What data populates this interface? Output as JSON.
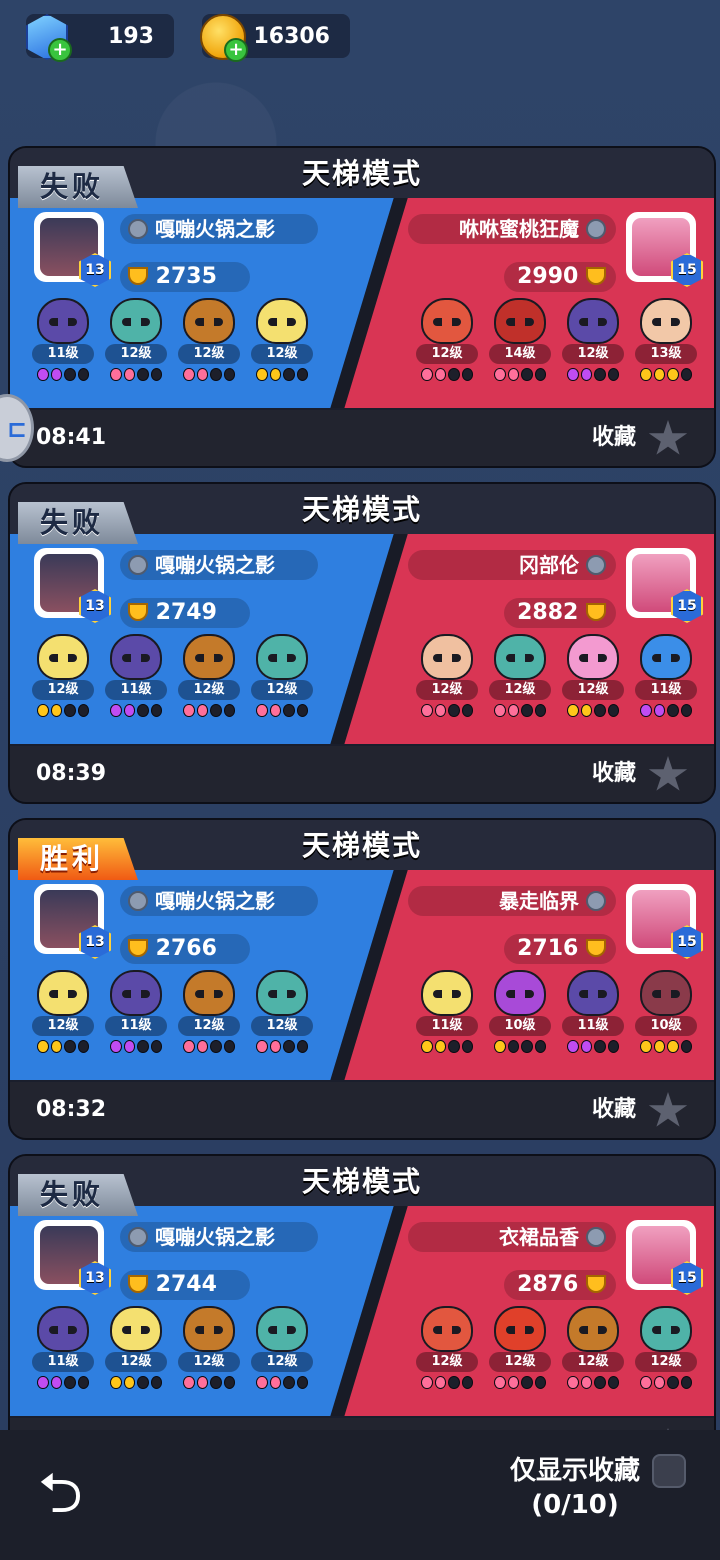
{
  "resources": {
    "gems": "193",
    "coins": "16306",
    "gem_icon": "gem-icon",
    "coin_icon": "coin-icon",
    "plus_symbol": "+"
  },
  "matches": [
    {
      "mode": "天梯模式",
      "result": "失败",
      "time": "08:41",
      "fav_label": "收藏",
      "left": {
        "name": "嘎嘣火锅之影",
        "score": "2735",
        "level": "13",
        "units": [
          {
            "lv": "11级",
            "color": "#5b4aa8",
            "dots": [
              "purple",
              "purple",
              "off",
              "off"
            ]
          },
          {
            "lv": "12级",
            "color": "#4fb3a8",
            "dots": [
              "pink",
              "pink",
              "off",
              "off"
            ]
          },
          {
            "lv": "12级",
            "color": "#c47a2a",
            "dots": [
              "pink",
              "pink",
              "off",
              "off"
            ]
          },
          {
            "lv": "12级",
            "color": "#f4e070",
            "dots": [
              "gold",
              "gold",
              "off",
              "off"
            ]
          }
        ]
      },
      "right": {
        "name": "咻咻蜜桃狂魔",
        "score": "2990",
        "level": "15",
        "units": [
          {
            "lv": "12级",
            "color": "#e2573f",
            "dots": [
              "pink",
              "pink",
              "off",
              "off"
            ]
          },
          {
            "lv": "14级",
            "color": "#c0302a",
            "dots": [
              "pink",
              "pink",
              "off",
              "off"
            ]
          },
          {
            "lv": "12级",
            "color": "#5b4aa8",
            "dots": [
              "purple",
              "purple",
              "off",
              "off"
            ]
          },
          {
            "lv": "13级",
            "color": "#f2c8a8",
            "dots": [
              "gold",
              "gold",
              "gold",
              "off"
            ]
          }
        ]
      }
    },
    {
      "mode": "天梯模式",
      "result": "失败",
      "time": "08:39",
      "fav_label": "收藏",
      "left": {
        "name": "嘎嘣火锅之影",
        "score": "2749",
        "level": "13",
        "units": [
          {
            "lv": "12级",
            "color": "#f4e070",
            "dots": [
              "gold",
              "gold",
              "off",
              "off"
            ]
          },
          {
            "lv": "11级",
            "color": "#5b4aa8",
            "dots": [
              "purple",
              "purple",
              "off",
              "off"
            ]
          },
          {
            "lv": "12级",
            "color": "#c47a2a",
            "dots": [
              "pink",
              "pink",
              "off",
              "off"
            ]
          },
          {
            "lv": "12级",
            "color": "#4fb3a8",
            "dots": [
              "pink",
              "pink",
              "off",
              "off"
            ]
          }
        ]
      },
      "right": {
        "name": "冈部伦",
        "score": "2882",
        "level": "15",
        "units": [
          {
            "lv": "12级",
            "color": "#f0c0a0",
            "dots": [
              "pink",
              "pink",
              "off",
              "off"
            ]
          },
          {
            "lv": "12级",
            "color": "#4fb3a8",
            "dots": [
              "pink",
              "pink",
              "off",
              "off"
            ]
          },
          {
            "lv": "12级",
            "color": "#f39ad0",
            "dots": [
              "gold",
              "gold",
              "off",
              "off"
            ]
          },
          {
            "lv": "11级",
            "color": "#3b8ee8",
            "dots": [
              "purple",
              "purple",
              "off",
              "off"
            ]
          }
        ]
      }
    },
    {
      "mode": "天梯模式",
      "result": "胜利",
      "time": "08:32",
      "fav_label": "收藏",
      "left": {
        "name": "嘎嘣火锅之影",
        "score": "2766",
        "level": "13",
        "units": [
          {
            "lv": "12级",
            "color": "#f4e070",
            "dots": [
              "gold",
              "gold",
              "off",
              "off"
            ]
          },
          {
            "lv": "11级",
            "color": "#5b4aa8",
            "dots": [
              "purple",
              "purple",
              "off",
              "off"
            ]
          },
          {
            "lv": "12级",
            "color": "#c47a2a",
            "dots": [
              "pink",
              "pink",
              "off",
              "off"
            ]
          },
          {
            "lv": "12级",
            "color": "#4fb3a8",
            "dots": [
              "pink",
              "pink",
              "off",
              "off"
            ]
          }
        ]
      },
      "right": {
        "name": "暴走临界",
        "score": "2716",
        "level": "15",
        "units": [
          {
            "lv": "11级",
            "color": "#f4e070",
            "dots": [
              "gold",
              "gold",
              "off",
              "off"
            ]
          },
          {
            "lv": "10级",
            "color": "#a84ad8",
            "dots": [
              "gold",
              "off",
              "off",
              "off"
            ]
          },
          {
            "lv": "11级",
            "color": "#5b4aa8",
            "dots": [
              "purple",
              "purple",
              "off",
              "off"
            ]
          },
          {
            "lv": "10级",
            "color": "#8a3a4a",
            "dots": [
              "gold",
              "gold",
              "gold",
              "off"
            ]
          }
        ]
      }
    },
    {
      "mode": "天梯模式",
      "result": "失败",
      "time": "",
      "fav_label": "",
      "left": {
        "name": "嘎嘣火锅之影",
        "score": "2744",
        "level": "13",
        "units": [
          {
            "lv": "11级",
            "color": "#5b4aa8",
            "dots": [
              "purple",
              "purple",
              "off",
              "off"
            ]
          },
          {
            "lv": "12级",
            "color": "#f4e070",
            "dots": [
              "gold",
              "gold",
              "off",
              "off"
            ]
          },
          {
            "lv": "12级",
            "color": "#c47a2a",
            "dots": [
              "pink",
              "pink",
              "off",
              "off"
            ]
          },
          {
            "lv": "12级",
            "color": "#4fb3a8",
            "dots": [
              "pink",
              "pink",
              "off",
              "off"
            ]
          }
        ]
      },
      "right": {
        "name": "衣裙品香",
        "score": "2876",
        "level": "15",
        "units": [
          {
            "lv": "12级",
            "color": "#e2573f",
            "dots": [
              "pink",
              "pink",
              "off",
              "off"
            ]
          },
          {
            "lv": "12级",
            "color": "#e0402a",
            "dots": [
              "pink",
              "pink",
              "off",
              "off"
            ]
          },
          {
            "lv": "12级",
            "color": "#c47a2a",
            "dots": [
              "pink",
              "pink",
              "off",
              "off"
            ]
          },
          {
            "lv": "12级",
            "color": "#4fb3a8",
            "dots": [
              "pink",
              "pink",
              "off",
              "off"
            ]
          }
        ]
      }
    }
  ],
  "bottom": {
    "only_fav_label": "仅显示收藏",
    "fav_count": "(0/10)",
    "back_icon": "back-arrow-icon"
  },
  "colors": {
    "blue_team": "#2f7fe0",
    "red_team": "#d93554",
    "card_bg": "#1a1e2c"
  }
}
